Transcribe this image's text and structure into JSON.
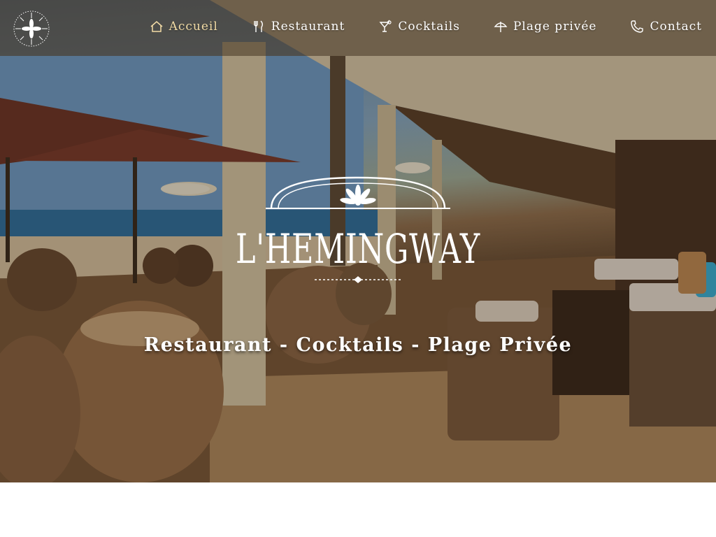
{
  "brand": {
    "name": "L'HEMINGWAY"
  },
  "nav": {
    "items": [
      {
        "label": "Accueil",
        "icon": "home-icon",
        "active": true
      },
      {
        "label": "Restaurant",
        "icon": "fork-knife-icon",
        "active": false
      },
      {
        "label": "Cocktails",
        "icon": "cocktail-icon",
        "active": false
      },
      {
        "label": "Plage privée",
        "icon": "umbrella-icon",
        "active": false
      },
      {
        "label": "Contact",
        "icon": "phone-icon",
        "active": false
      }
    ]
  },
  "hero": {
    "tagline": "Restaurant - Cocktails - Plage Privée"
  },
  "colors": {
    "nav_bar": "#463422",
    "nav_active": "#f3dca6",
    "text": "#ffffff"
  }
}
